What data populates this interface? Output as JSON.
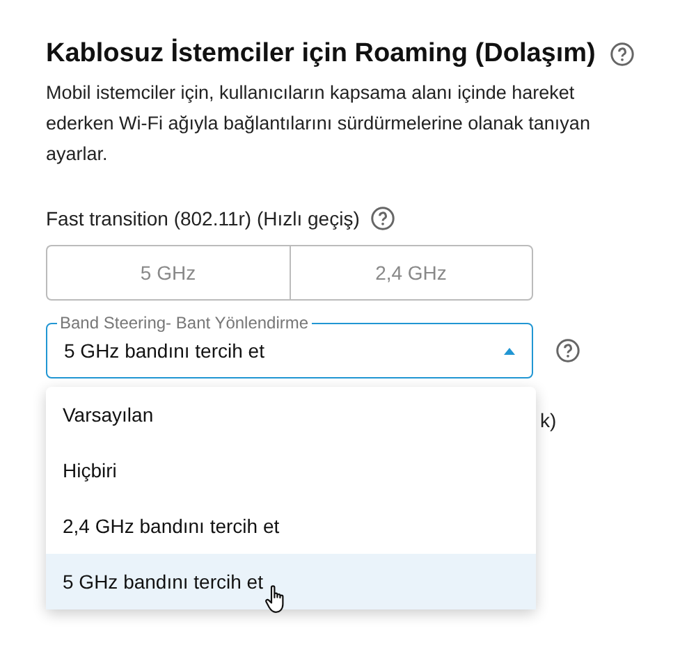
{
  "section": {
    "title": "Kablosuz İstemciler için Roaming (Dolaşım)",
    "description": "Mobil istemciler için, kullanıcıların kapsama alanı içinde hareket ederken Wi-Fi ağıyla bağlantılarını sürdürmelerine olanak tanıyan ayarlar."
  },
  "fast_transition": {
    "label": "Fast transition (802.11r) (Hızlı geçiş)",
    "bands": [
      {
        "label": "5 GHz",
        "selected": false
      },
      {
        "label": "2,4 GHz",
        "selected": false
      }
    ]
  },
  "band_steering": {
    "label": "Band Steering- Bant Yönlendirme",
    "value": "5 GHz bandını tercih et",
    "expanded": true,
    "options": [
      {
        "label": "Varsayılan",
        "selected": false
      },
      {
        "label": "Hiçbiri",
        "selected": false
      },
      {
        "label": "2,4 GHz bandını tercih et",
        "selected": false
      },
      {
        "label": "5 GHz bandını tercih et",
        "selected": true
      }
    ]
  },
  "hidden_text": "k)"
}
